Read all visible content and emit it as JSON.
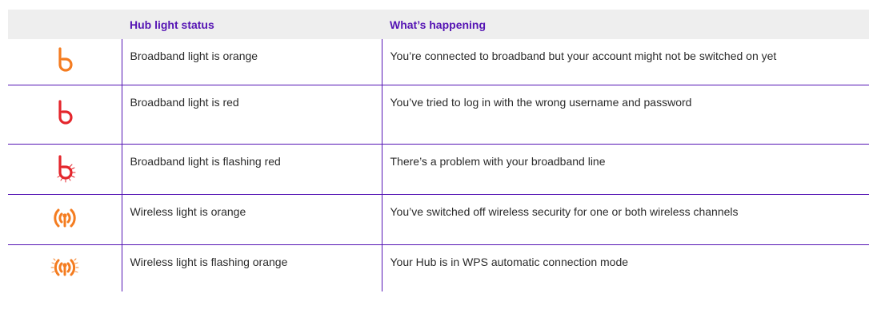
{
  "table": {
    "headers": [
      "",
      "Hub light status",
      "What’s happening"
    ],
    "rows": [
      {
        "icon": "broadband-orange-icon",
        "icon_color": "#f47c20",
        "status": "Broadband light is orange",
        "what": "You’re connected to broadband but your account might not be switched on yet"
      },
      {
        "icon": "broadband-red-icon",
        "icon_color": "#e4262c",
        "status": "Broadband light is red",
        "what": "You’ve tried to log in with the wrong username and password"
      },
      {
        "icon": "broadband-flashing-red-icon",
        "icon_color": "#e4262c",
        "status": "Broadband light is flashing red",
        "what": "There’s a problem with your broadband line"
      },
      {
        "icon": "wireless-orange-icon",
        "icon_color": "#f47c20",
        "status": "Wireless light is orange",
        "what": "You’ve switched off wireless security for one or both wireless channels"
      },
      {
        "icon": "wireless-flashing-orange-icon",
        "icon_color": "#f47c20",
        "status": "Wireless light is flashing orange",
        "what": "Your Hub is in WPS automatic connection mode"
      }
    ]
  },
  "colors": {
    "accent": "#5514b4",
    "header_bg": "#eeeeee",
    "orange": "#f47c20",
    "red": "#e4262c"
  }
}
